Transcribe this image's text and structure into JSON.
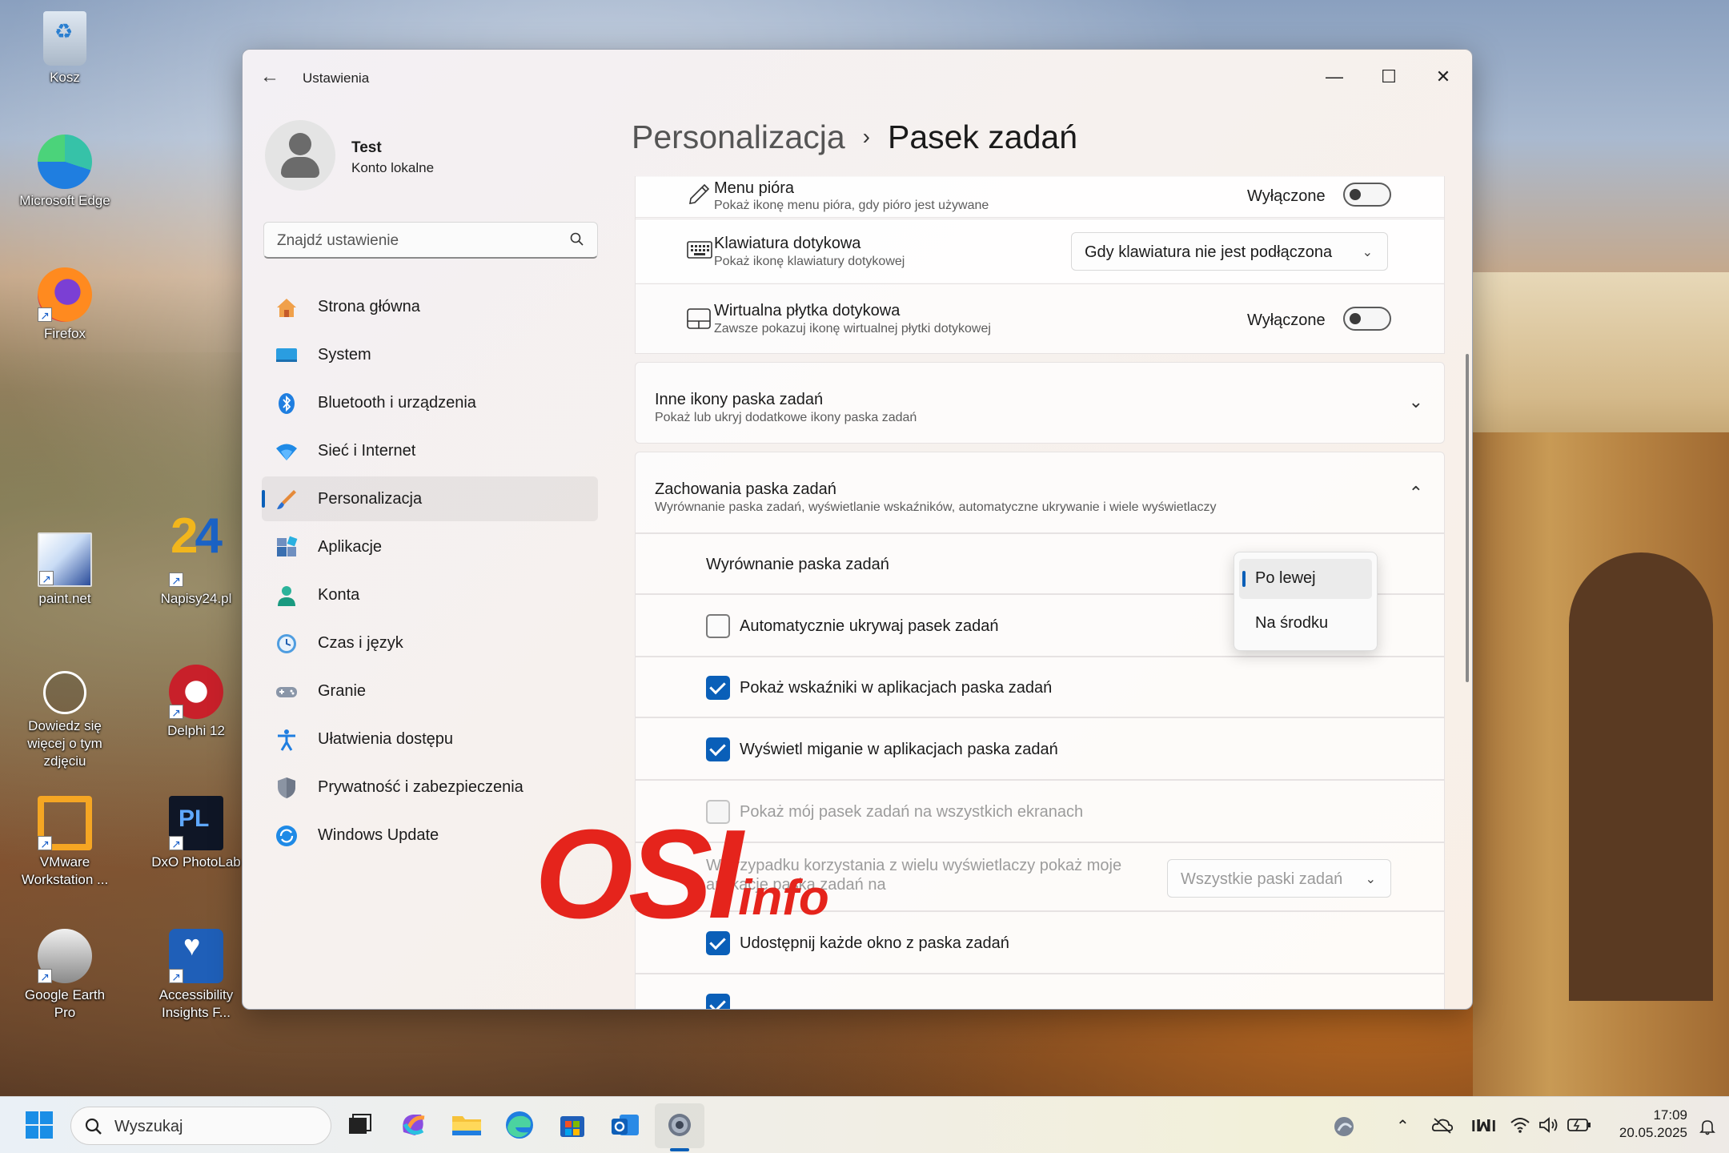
{
  "desktop": {
    "icons": [
      {
        "label": "Kosz"
      },
      {
        "label": "Microsoft Edge"
      },
      {
        "label": "Firefox"
      },
      {
        "label": "paint.net"
      },
      {
        "label": "Napisy24.pl"
      },
      {
        "label": "Dowiedz się więcej o tym zdjęciu"
      },
      {
        "label": "Delphi 12"
      },
      {
        "label": "VMware Workstation ..."
      },
      {
        "label": "DxO PhotoLab"
      },
      {
        "label": "Google Earth Pro"
      },
      {
        "label": "Accessibility Insights F..."
      }
    ]
  },
  "window": {
    "title": "Ustawienia",
    "controls": {
      "minimize": "—",
      "maximize": "☐",
      "close": "✕"
    }
  },
  "user": {
    "name": "Test",
    "account": "Konto lokalne"
  },
  "search": {
    "placeholder": "Znajdź ustawienie"
  },
  "nav": [
    {
      "label": "Strona główna",
      "icon": "home-icon"
    },
    {
      "label": "System",
      "icon": "system-icon"
    },
    {
      "label": "Bluetooth i urządzenia",
      "icon": "bluetooth-icon"
    },
    {
      "label": "Sieć i Internet",
      "icon": "wifi-icon"
    },
    {
      "label": "Personalizacja",
      "icon": "brush-icon",
      "active": true
    },
    {
      "label": "Aplikacje",
      "icon": "apps-icon"
    },
    {
      "label": "Konta",
      "icon": "account-icon"
    },
    {
      "label": "Czas i język",
      "icon": "clock-icon"
    },
    {
      "label": "Granie",
      "icon": "gamepad-icon"
    },
    {
      "label": "Ułatwienia dostępu",
      "icon": "accessibility-icon"
    },
    {
      "label": "Prywatność i zabezpieczenia",
      "icon": "shield-icon"
    },
    {
      "label": "Windows Update",
      "icon": "update-icon"
    }
  ],
  "breadcrumb": {
    "parent": "Personalizacja",
    "separator": "›",
    "current": "Pasek zadań"
  },
  "rows": {
    "pen": {
      "title": "Menu pióra",
      "sub": "Pokaż ikonę menu pióra, gdy pióro jest używane",
      "state": "Wyłączone"
    },
    "keyboard": {
      "title": "Klawiatura dotykowa",
      "sub": "Pokaż ikonę klawiatury dotykowej",
      "value": "Gdy klawiatura nie jest podłączona"
    },
    "touchpad": {
      "title": "Wirtualna płytka dotykowa",
      "sub": "Zawsze pokazuj ikonę wirtualnej płytki dotykowej",
      "state": "Wyłączone"
    }
  },
  "other_icons": {
    "title": "Inne ikony paska zadań",
    "sub": "Pokaż lub ukryj dodatkowe ikony paska zadań"
  },
  "behaviors": {
    "title": "Zachowania paska zadań",
    "sub": "Wyrównanie paska zadań, wyświetlanie wskaźników, automatyczne ukrywanie i wiele wyświetlaczy",
    "alignment_label": "Wyrównanie paska zadań",
    "autohide": "Automatycznie ukrywaj pasek zadań",
    "badges": "Pokaż wskaźniki w aplikacjach paska zadań",
    "flashing": "Wyświetl miganie w aplikacjach paska zadań",
    "all_displays": "Pokaż mój pasek zadań na wszystkich ekranach",
    "multi_display": "W przypadku korzystania z wielu wyświetlaczy pokaż moje aplikacje paska zadań na",
    "multi_display_value": "Wszystkie paski zadań",
    "share_window": "Udostępnij każde okno z paska zadań",
    "checked": {
      "autohide": false,
      "badges": true,
      "flashing": true,
      "all_displays": false,
      "share_window": true
    }
  },
  "alignment_popup": {
    "options": [
      "Po lewej",
      "Na środku"
    ],
    "selected": "Po lewej"
  },
  "watermark": {
    "main": "OSI",
    "sub": "info"
  },
  "taskbar": {
    "search_placeholder": "Wyszukaj",
    "time": "17:09",
    "date": "20.05.2025"
  },
  "colors": {
    "accent": "#0a5fb8",
    "watermark": "#e5241c"
  }
}
